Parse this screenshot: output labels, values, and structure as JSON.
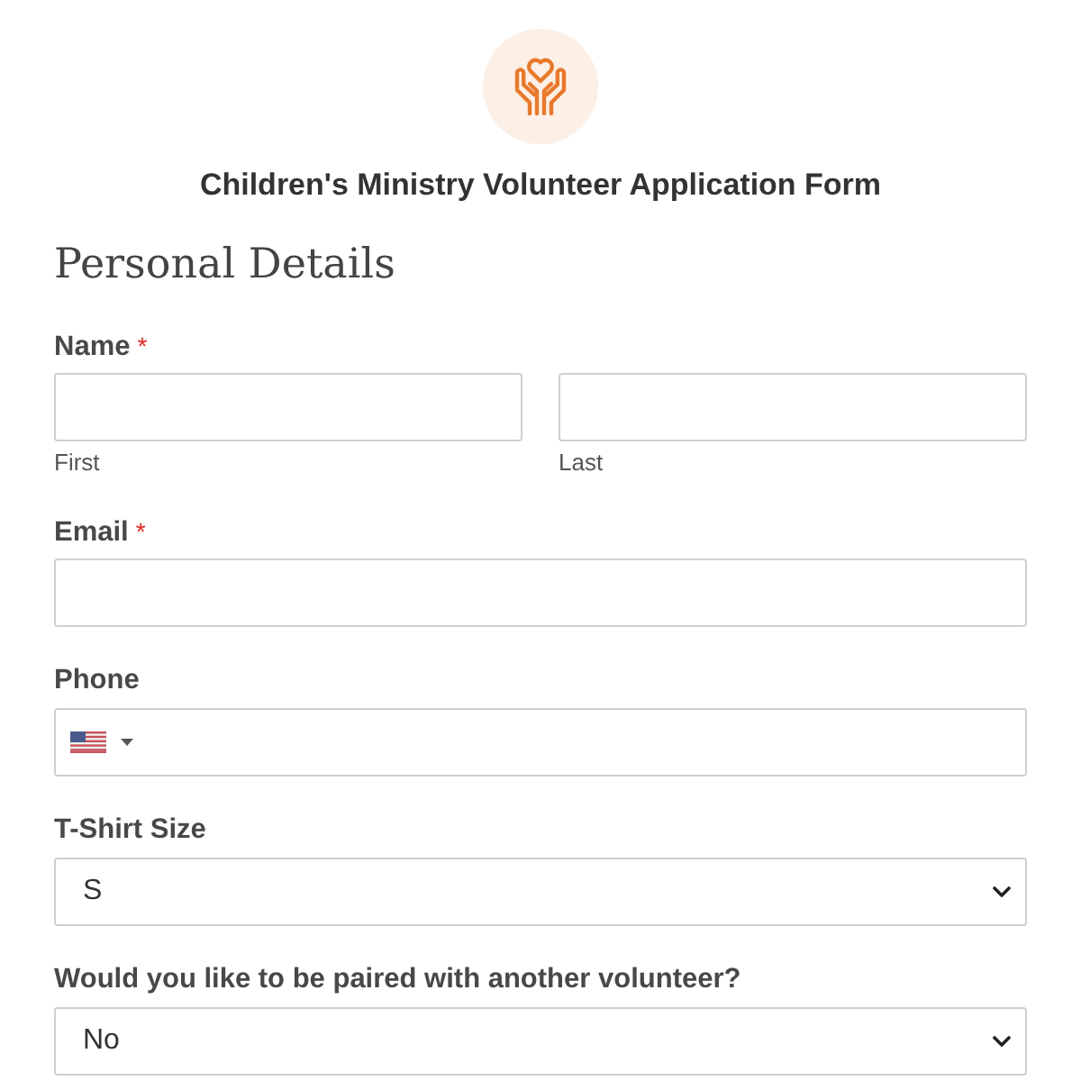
{
  "form": {
    "title": "Children's Ministry Volunteer Application Form"
  },
  "section": {
    "heading": "Personal Details"
  },
  "fields": [
    {
      "kind": "name-pair",
      "label": "Name",
      "required_mark": "*",
      "sublabels": [
        "First",
        "Last"
      ]
    },
    {
      "kind": "text",
      "label": "Email",
      "required_mark": "*"
    },
    {
      "kind": "phone",
      "label": "Phone"
    },
    {
      "kind": "select",
      "label": "T-Shirt Size",
      "value": "S"
    },
    {
      "kind": "select",
      "label": "Would you like to be paired with another volunteer?",
      "value": "No"
    }
  ]
}
